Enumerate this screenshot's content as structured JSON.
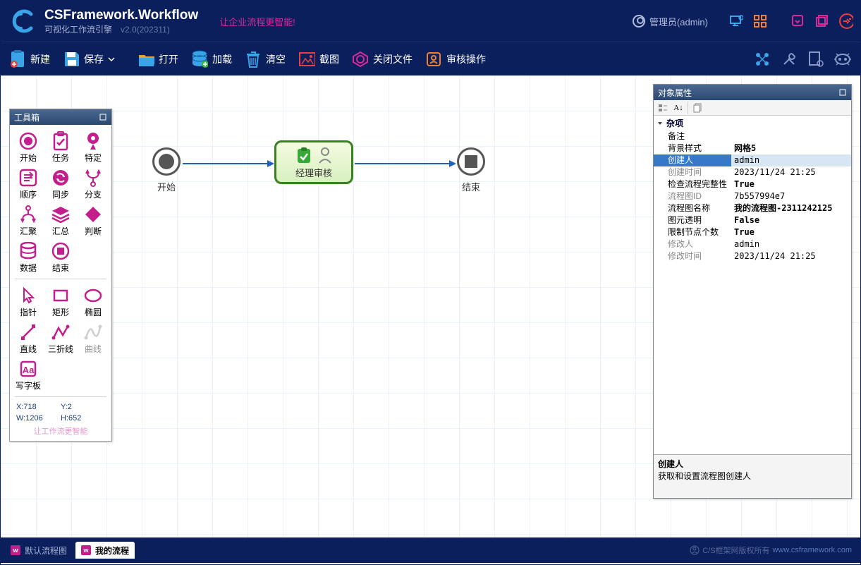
{
  "header": {
    "title": "CSFramework.Workflow",
    "subtitle": "可视化工作流引擎",
    "version": "v2.0(202311)",
    "slogan": "让企业流程更智能!",
    "user": "管理员(admin)"
  },
  "toolbar": {
    "new": "新建",
    "save": "保存",
    "open": "打开",
    "load": "加载",
    "clear": "清空",
    "screenshot": "截图",
    "closeFile": "关闭文件",
    "auditOp": "审核操作"
  },
  "toolbox": {
    "title": "工具箱",
    "tools": {
      "start": "开始",
      "task": "任务",
      "specific": "特定",
      "sequence": "顺序",
      "sync": "同步",
      "branch": "分支",
      "converge": "汇聚",
      "summary": "汇总",
      "judge": "判断",
      "data": "数据",
      "end": "结束",
      "pointer": "指针",
      "rect": "矩形",
      "ellipse": "椭圆",
      "line": "直线",
      "polyline": "三折线",
      "curve": "曲线",
      "textboard": "写字板"
    },
    "coords": {
      "x": "X:718",
      "y": "Y:2",
      "w": "W:1206",
      "h": "H:652"
    },
    "slogan": "让工作流更智能"
  },
  "canvas": {
    "startLabel": "开始",
    "taskLabel": "经理审核",
    "endLabel": "结束"
  },
  "props": {
    "title": "对象属性",
    "category": "杂项",
    "rows": [
      {
        "k": "备注",
        "v": "",
        "gray": false
      },
      {
        "k": "背景样式",
        "v": "网格5",
        "bold": true
      },
      {
        "k": "创建人",
        "v": "admin",
        "gray": true,
        "sel": true
      },
      {
        "k": "创建时间",
        "v": "2023/11/24 21:25",
        "gray": true
      },
      {
        "k": "检查流程完整性",
        "v": "True",
        "bold": true
      },
      {
        "k": "流程图ID",
        "v": "7b557994e7",
        "gray": true
      },
      {
        "k": "流程图名称",
        "v": "我的流程图-2311242125",
        "bold": true
      },
      {
        "k": "图元透明",
        "v": "False",
        "bold": true
      },
      {
        "k": "限制节点个数",
        "v": "True",
        "bold": true
      },
      {
        "k": "修改人",
        "v": "admin",
        "gray": true
      },
      {
        "k": "修改时间",
        "v": "2023/11/24 21:25",
        "gray": true
      }
    ],
    "helpTitle": "创建人",
    "helpText": "获取和设置流程图创建人"
  },
  "statusbar": {
    "tab1": "默认流程图",
    "tab2": "我的流程",
    "copyright": "C/S框架网版权所有",
    "link": "www.csframework.com"
  }
}
